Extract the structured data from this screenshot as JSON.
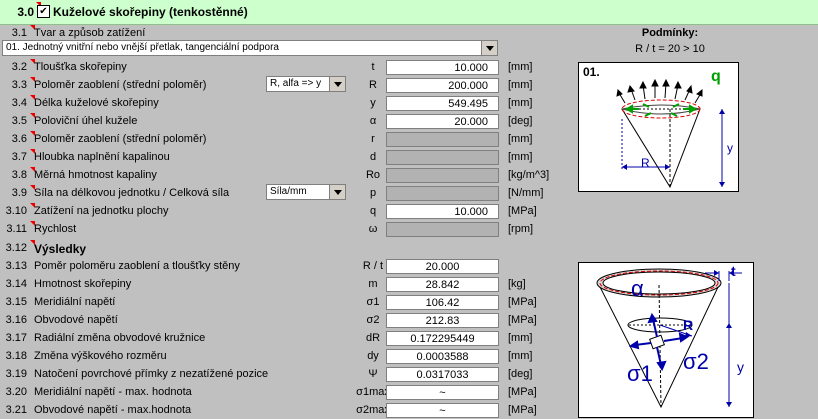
{
  "header": {
    "section_num": "3.0",
    "checkbox": "✔",
    "title": "Kuželové skořepiny (tenkostěnné)"
  },
  "shape_section": {
    "num": "3.1",
    "label": "Tvar a způsob zatížení",
    "selected": "01. Jednotný vnitřní nebo vnější přetlak, tangenciální podpora"
  },
  "conditions": {
    "title": "Podmínky:",
    "text": "R / t = 20 > 10"
  },
  "inputs": [
    {
      "num": "3.2",
      "label": "Tloušťka skořepiny",
      "sym": "t",
      "value": "10.000",
      "unit": "[mm]"
    },
    {
      "num": "3.3",
      "label": "Poloměr zaoblení (střední poloměr)",
      "sym": "R",
      "value": "200.000",
      "unit": "[mm]"
    },
    {
      "num": "3.4",
      "label": "Délka kuželové skořepiny",
      "sym": "y",
      "value": "549.495",
      "unit": "[mm]"
    },
    {
      "num": "3.5",
      "label": "Poloviční úhel kužele",
      "sym": "α",
      "value": "20.000",
      "unit": "[deg]"
    },
    {
      "num": "3.6",
      "label": "Poloměr zaoblení (střední poloměr)",
      "sym": "r",
      "value": "",
      "unit": "[mm]"
    },
    {
      "num": "3.7",
      "label": "Hloubka naplnění kapalinou",
      "sym": "d",
      "value": "",
      "unit": "[mm]"
    },
    {
      "num": "3.8",
      "label": "Měrná hmotnost kapaliny",
      "sym": "Ro",
      "value": "",
      "unit": "[kg/m^3]"
    },
    {
      "num": "3.9",
      "label": "Síla na délkovou jednotku / Celková síla",
      "sym": "p",
      "value": "",
      "unit": "[N/mm]"
    },
    {
      "num": "3.10",
      "label": "Zatížení na jednotku plochy",
      "sym": "q",
      "value": "10.000",
      "unit": "[MPa]"
    },
    {
      "num": "3.11",
      "label": "Rychlost",
      "sym": "ω",
      "value": "",
      "unit": "[rpm]"
    }
  ],
  "combo_radius": "R, alfa => y",
  "combo_force": "Síla/mm",
  "results_header": {
    "num": "3.12",
    "label": "Výsledky"
  },
  "results": [
    {
      "num": "3.13",
      "label": "Poměr poloměru zaoblení a tloušťky stěny",
      "sym": "R / t",
      "value": "20.000",
      "unit": ""
    },
    {
      "num": "3.14",
      "label": "Hmotnost skořepiny",
      "sym": "m",
      "value": "28.842",
      "unit": "[kg]"
    },
    {
      "num": "3.15",
      "label": "Meridiální napětí",
      "sym": "σ1",
      "value": "106.42",
      "unit": "[MPa]"
    },
    {
      "num": "3.16",
      "label": "Obvodové napětí",
      "sym": "σ2",
      "value": "212.83",
      "unit": "[MPa]"
    },
    {
      "num": "3.17",
      "label": "Radiální změna obvodové kružnice",
      "sym": "dR",
      "value": "0.172295449",
      "unit": "[mm]"
    },
    {
      "num": "3.18",
      "label": "Změna výškového rozměru",
      "sym": "dy",
      "value": "0.0003588",
      "unit": "[mm]"
    },
    {
      "num": "3.19",
      "label": "Natočení povrchové přímky z nezatížené pozice",
      "sym": "Ψ",
      "value": "0.0317033",
      "unit": "[deg]"
    },
    {
      "num": "3.20",
      "label": "Meridiální napětí - max. hodnota",
      "sym": "σ1max",
      "value": "~",
      "unit": "[MPa]"
    },
    {
      "num": "3.21",
      "label": "Obvodové napětí - max.hodnota",
      "sym": "σ2max",
      "value": "~",
      "unit": "[MPa]"
    }
  ],
  "diagram1": {
    "case": "01.",
    "q": "q",
    "R": "R",
    "y": "y"
  },
  "diagram2": {
    "t": "t",
    "alpha": "α",
    "R": "R",
    "sigma1": "σ1",
    "sigma2": "σ2",
    "y": "y"
  }
}
